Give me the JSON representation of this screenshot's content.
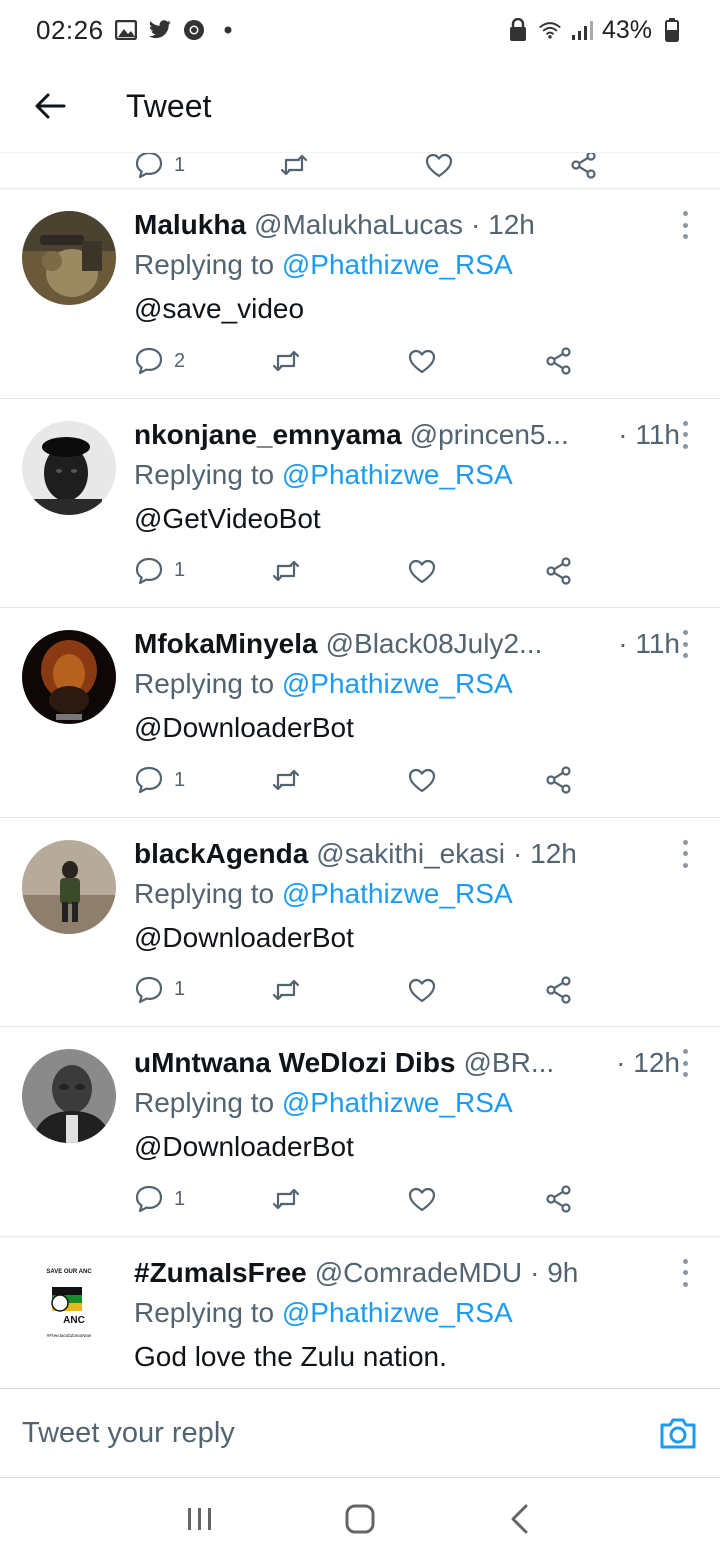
{
  "status_bar": {
    "time": "02:26",
    "battery": "43%"
  },
  "header": {
    "title": "Tweet"
  },
  "prev_actions": {
    "reply_count": "1"
  },
  "tweets": [
    {
      "name": "Malukha",
      "handle": "@MalukhaLucas",
      "time": "· 12h",
      "replying_label": "Replying to",
      "replying_to": "@Phathizwe_RSA",
      "text": "@save_video",
      "text_is_mention": true,
      "replies": "2"
    },
    {
      "name": "nkonjane_emnyama",
      "handle": "@princen5...",
      "time": "· 11h",
      "replying_label": "Replying to",
      "replying_to": "@Phathizwe_RSA",
      "text": "@GetVideoBot",
      "text_is_mention": true,
      "replies": "1"
    },
    {
      "name": "MfokaMinyela",
      "handle": "@Black08July2...",
      "time": "· 11h",
      "replying_label": "Replying to",
      "replying_to": "@Phathizwe_RSA",
      "text": "@DownloaderBot",
      "text_is_mention": true,
      "replies": "1"
    },
    {
      "name": "blackAgenda",
      "handle": "@sakithi_ekasi",
      "time": "· 12h",
      "replying_label": "Replying to",
      "replying_to": "@Phathizwe_RSA",
      "text": "@DownloaderBot",
      "text_is_mention": true,
      "replies": "1"
    },
    {
      "name": "uMntwana WeDlozi Dibs",
      "handle": "@BR...",
      "time": "· 12h",
      "replying_label": "Replying to",
      "replying_to": "@Phathizwe_RSA",
      "text": "@DownloaderBot",
      "text_is_mention": true,
      "replies": "1"
    },
    {
      "name": "#ZumaIsFree",
      "handle": "@ComradeMDU",
      "time": "· 9h",
      "replying_label": "Replying to",
      "replying_to": "@Phathizwe_RSA",
      "text": "God love the Zulu nation.",
      "text_is_mention": false,
      "replies": ""
    }
  ],
  "avatar_zuma": {
    "top_text": "SAVE OUR ANC",
    "logo_text": "ANC",
    "bottom_text": "#FreeJacobZumaNow"
  },
  "reply_bar": {
    "placeholder": "Tweet your reply"
  },
  "colors": {
    "accent": "#1d9bf0",
    "text": "#0f1419",
    "muted": "#536471"
  },
  "icons": [
    "back-arrow-icon",
    "reply-icon",
    "retweet-icon",
    "like-icon",
    "share-icon",
    "camera-icon",
    "more-icon"
  ]
}
